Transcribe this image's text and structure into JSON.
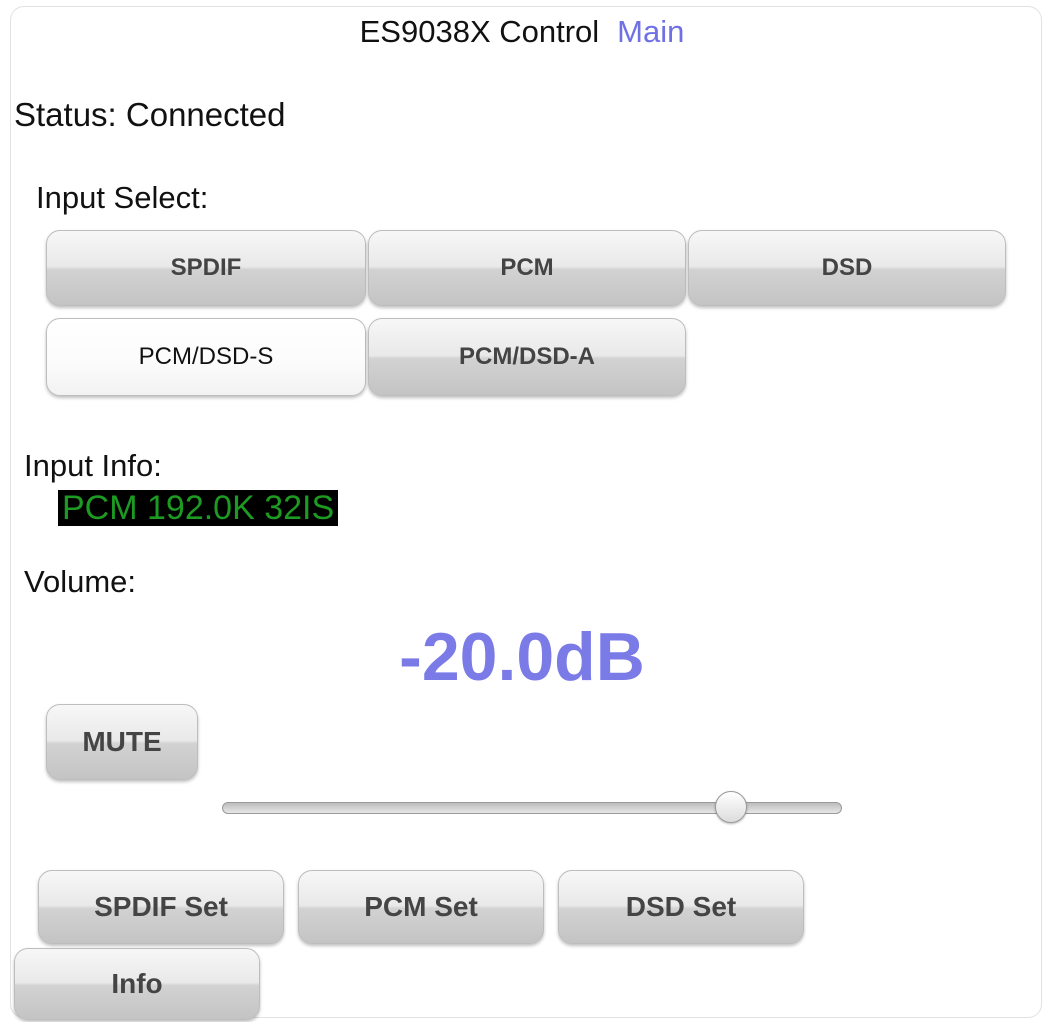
{
  "header": {
    "title": "ES9038X Control",
    "link": "Main"
  },
  "status": {
    "text": "Status: Connected"
  },
  "input_select": {
    "label": "Input Select:",
    "buttons": [
      "SPDIF",
      "PCM",
      "DSD",
      "PCM/DSD-S",
      "PCM/DSD-A"
    ],
    "selected": "PCM/DSD-S"
  },
  "input_info": {
    "label": "Input Info:",
    "value": "PCM 192.0K 32IS"
  },
  "volume": {
    "label": "Volume:",
    "value": "-20.0dB",
    "mute_label": "MUTE",
    "slider_fraction": 0.82
  },
  "presets": {
    "spdif_set": "SPDIF Set",
    "pcm_set": "PCM Set",
    "dsd_set": "DSD Set",
    "info": "Info"
  },
  "colors": {
    "accent": "#7b7be8",
    "link": "#6f6fe6",
    "info_text": "#1d9a22",
    "info_bg": "#000000"
  }
}
